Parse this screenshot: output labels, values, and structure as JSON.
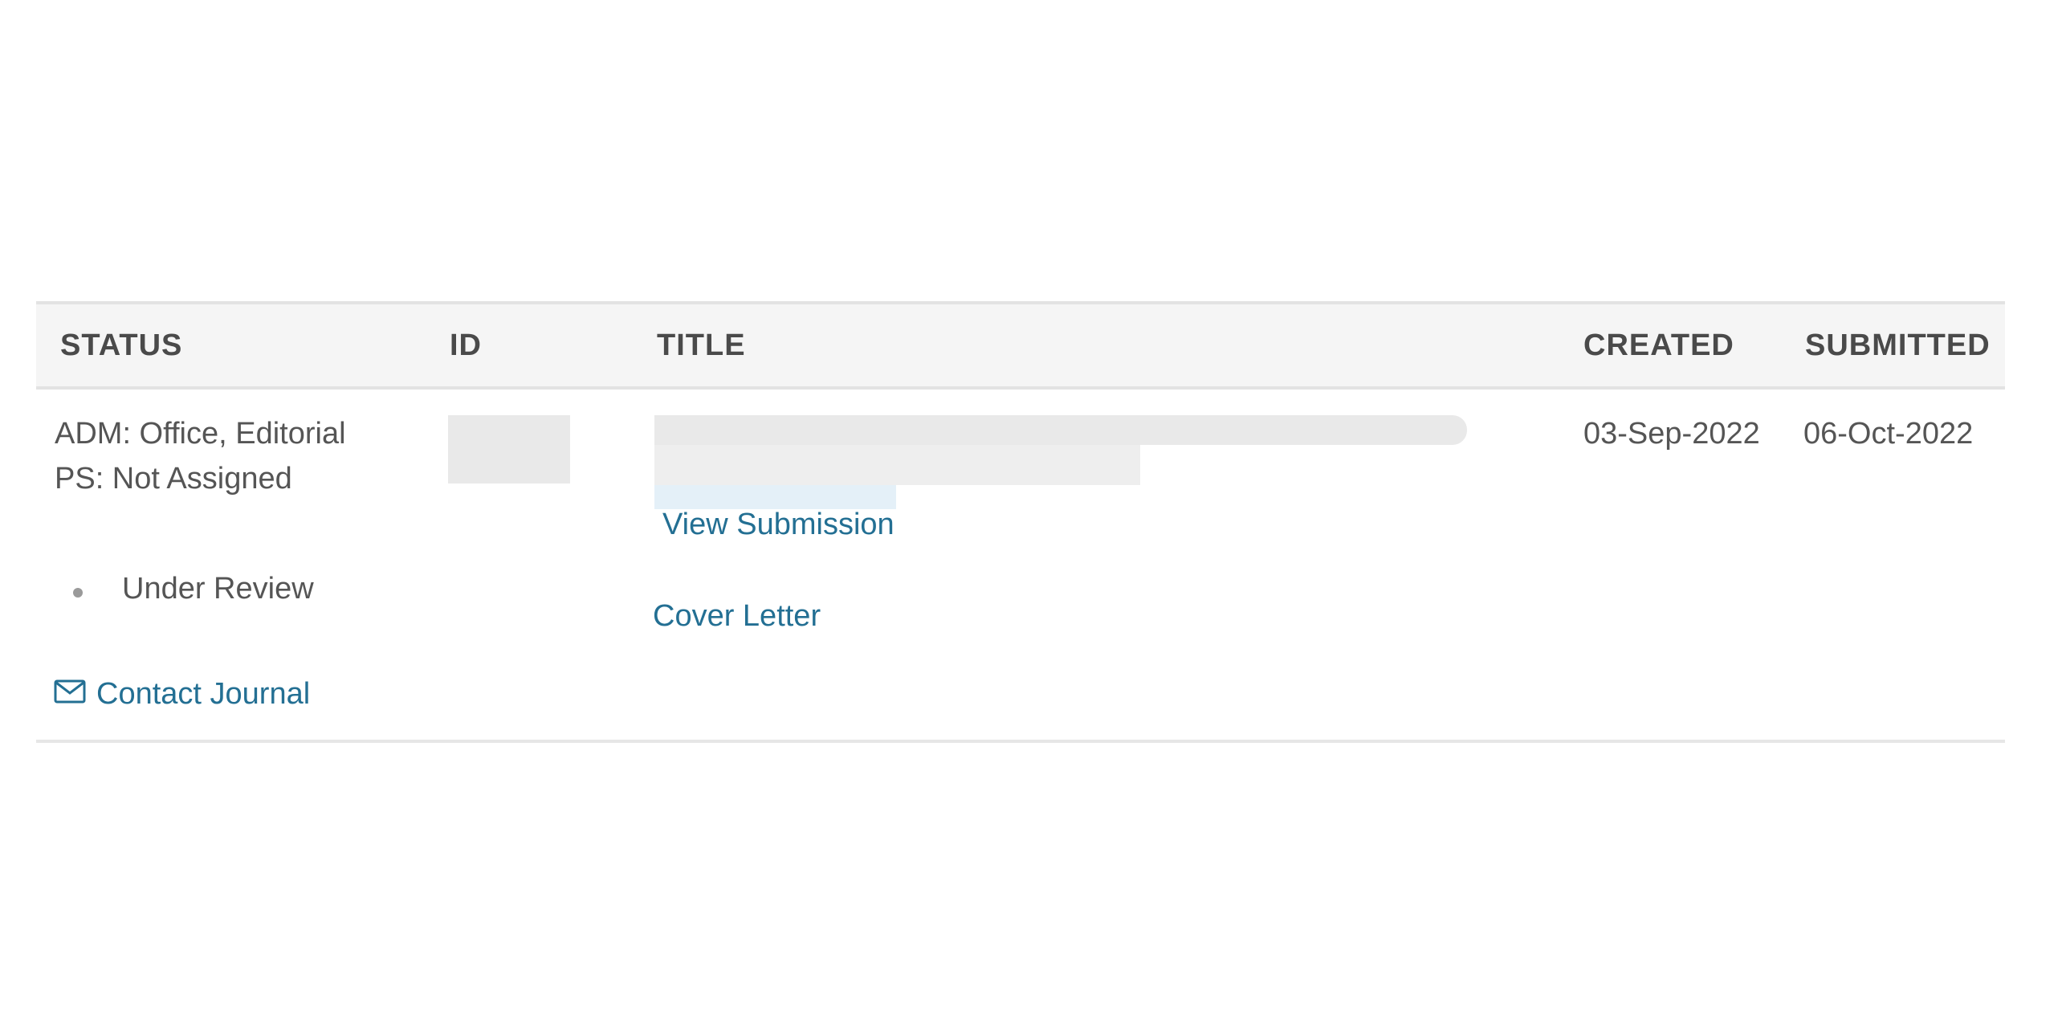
{
  "table": {
    "headers": {
      "status": "STATUS",
      "id": "ID",
      "title": "TITLE",
      "created": "CREATED",
      "submitted": "SUBMITTED"
    },
    "rows": [
      {
        "status_lines": [
          "ADM: Office, Editorial",
          "PS: Not Assigned"
        ],
        "status_bullet": "Under Review",
        "contact_link": "Contact Journal",
        "contact_icon": "envelope-icon",
        "id": "[redacted]",
        "title": "[redacted]",
        "view_submission_link": "View Submission",
        "cover_letter_link": "Cover Letter",
        "created": "03-Sep-2022",
        "submitted": "06-Oct-2022"
      }
    ]
  },
  "colors": {
    "link": "#236f93",
    "header_bg": "#f5f5f5",
    "text": "#555555"
  }
}
